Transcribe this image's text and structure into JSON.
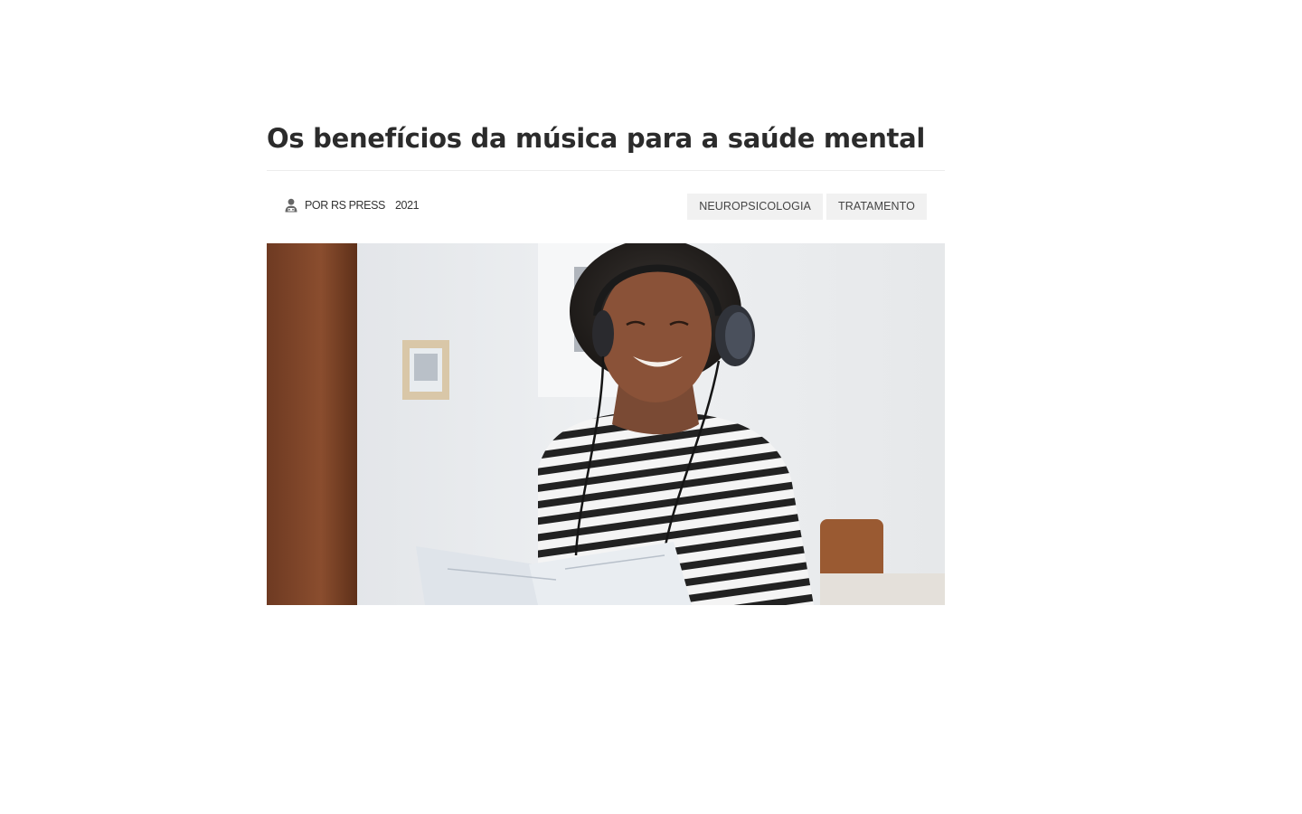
{
  "article": {
    "title": "Os benefícios da música para a saúde mental",
    "author_label": "POR RS PRESS",
    "year": "2021",
    "tags": [
      "NEUROPSICOLOGIA",
      "TRATAMENTO"
    ]
  },
  "icons": {
    "author": "user-icon"
  },
  "colors": {
    "title": "#2b2b2b",
    "tag_bg": "#f1f1f1",
    "tag_text": "#444444",
    "divider": "#ececec"
  }
}
